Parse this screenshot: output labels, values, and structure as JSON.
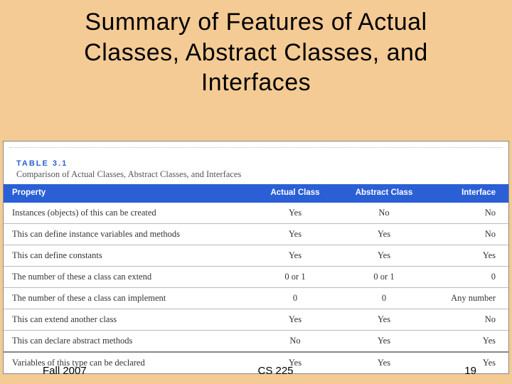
{
  "title": "Summary of Features of Actual Classes, Abstract Classes, and Interfaces",
  "table": {
    "label": "TABLE 3.1",
    "caption": "Comparison of Actual Classes, Abstract Classes, and Interfaces",
    "headers": {
      "property": "Property",
      "actual": "Actual Class",
      "abstract": "Abstract Class",
      "interface": "Interface"
    },
    "rows": [
      {
        "prop": "Instances (objects) of this can be created",
        "actual": "Yes",
        "abstract": "No",
        "interface": "No"
      },
      {
        "prop": "This can define instance variables and methods",
        "actual": "Yes",
        "abstract": "Yes",
        "interface": "No"
      },
      {
        "prop": "This can define constants",
        "actual": "Yes",
        "abstract": "Yes",
        "interface": "Yes"
      },
      {
        "prop": "The number of these a class can extend",
        "actual": "0 or 1",
        "abstract": "0 or 1",
        "interface": "0"
      },
      {
        "prop": "The number of these a class can implement",
        "actual": "0",
        "abstract": "0",
        "interface": "Any number"
      },
      {
        "prop": "This can extend another class",
        "actual": "Yes",
        "abstract": "Yes",
        "interface": "No"
      },
      {
        "prop": "This can declare abstract methods",
        "actual": "No",
        "abstract": "Yes",
        "interface": "Yes"
      },
      {
        "prop": "Variables of this type can be declared",
        "actual": "Yes",
        "abstract": "Yes",
        "interface": "Yes"
      }
    ]
  },
  "footer": {
    "left": "Fall 2007",
    "center": "CS 225",
    "right": "19"
  },
  "chart_data": {
    "type": "table",
    "title": "Comparison of Actual Classes, Abstract Classes, and Interfaces",
    "columns": [
      "Property",
      "Actual Class",
      "Abstract Class",
      "Interface"
    ],
    "rows": [
      [
        "Instances (objects) of this can be created",
        "Yes",
        "No",
        "No"
      ],
      [
        "This can define instance variables and methods",
        "Yes",
        "Yes",
        "No"
      ],
      [
        "This can define constants",
        "Yes",
        "Yes",
        "Yes"
      ],
      [
        "The number of these a class can extend",
        "0 or 1",
        "0 or 1",
        "0"
      ],
      [
        "The number of these a class can implement",
        "0",
        "0",
        "Any number"
      ],
      [
        "This can extend another class",
        "Yes",
        "Yes",
        "No"
      ],
      [
        "This can declare abstract methods",
        "No",
        "Yes",
        "Yes"
      ],
      [
        "Variables of this type can be declared",
        "Yes",
        "Yes",
        "Yes"
      ]
    ]
  }
}
